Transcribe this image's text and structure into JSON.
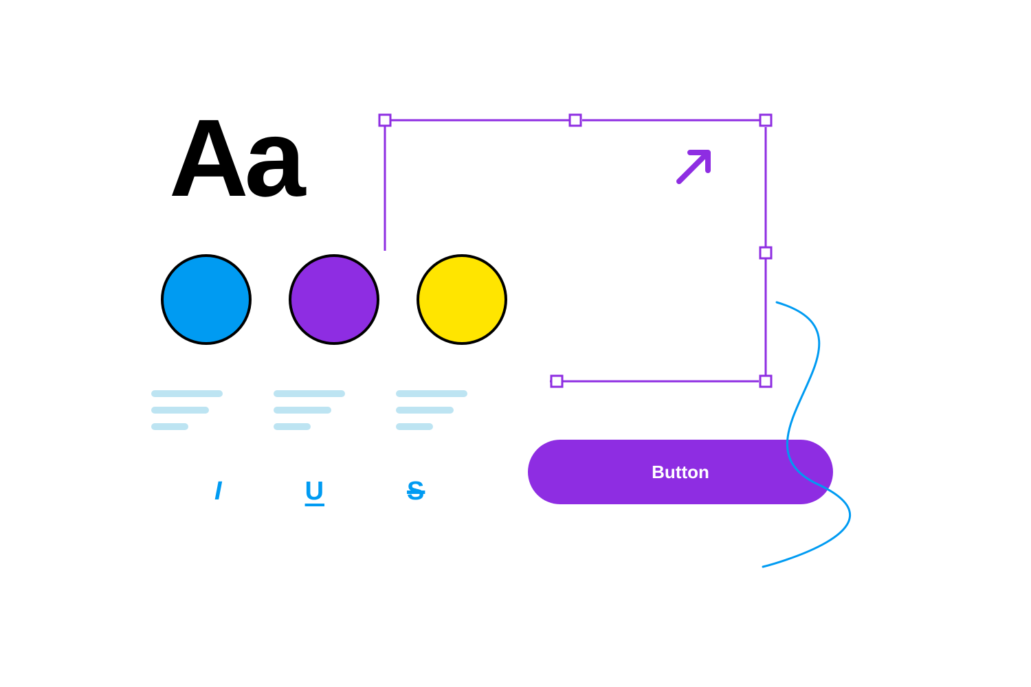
{
  "typography": {
    "sample": "Aa"
  },
  "swatches": {
    "blue": "#009bf2",
    "purple": "#8e2de2",
    "yellow": "#ffe500"
  },
  "text_styles": {
    "italic_glyph": "I",
    "underline_glyph": "U",
    "strike_glyph": "S"
  },
  "button": {
    "label": "Button"
  },
  "colors": {
    "selection_purple": "#8e2de2",
    "accent_blue": "#009bf2",
    "text_line_blue": "#bde4f2",
    "black": "#000000",
    "white": "#ffffff"
  }
}
